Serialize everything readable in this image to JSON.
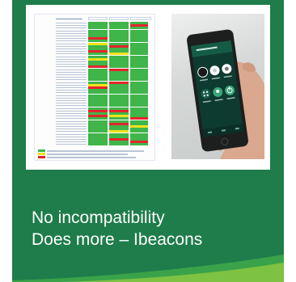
{
  "caption": {
    "line1": "No incompatibility",
    "line2": "Does more – Ibeacons"
  },
  "images": {
    "left": {
      "icon": "compatibility-table-image"
    },
    "right": {
      "icon": "phone-in-hand-image"
    }
  },
  "colors": {
    "card_green": "#1e7d4a",
    "swoosh_light": "#7dc242",
    "swoosh_mid": "#3aa34a",
    "table_green": "#3fb54a",
    "table_red": "#e3262b",
    "table_yellow": "#f2e21c"
  }
}
